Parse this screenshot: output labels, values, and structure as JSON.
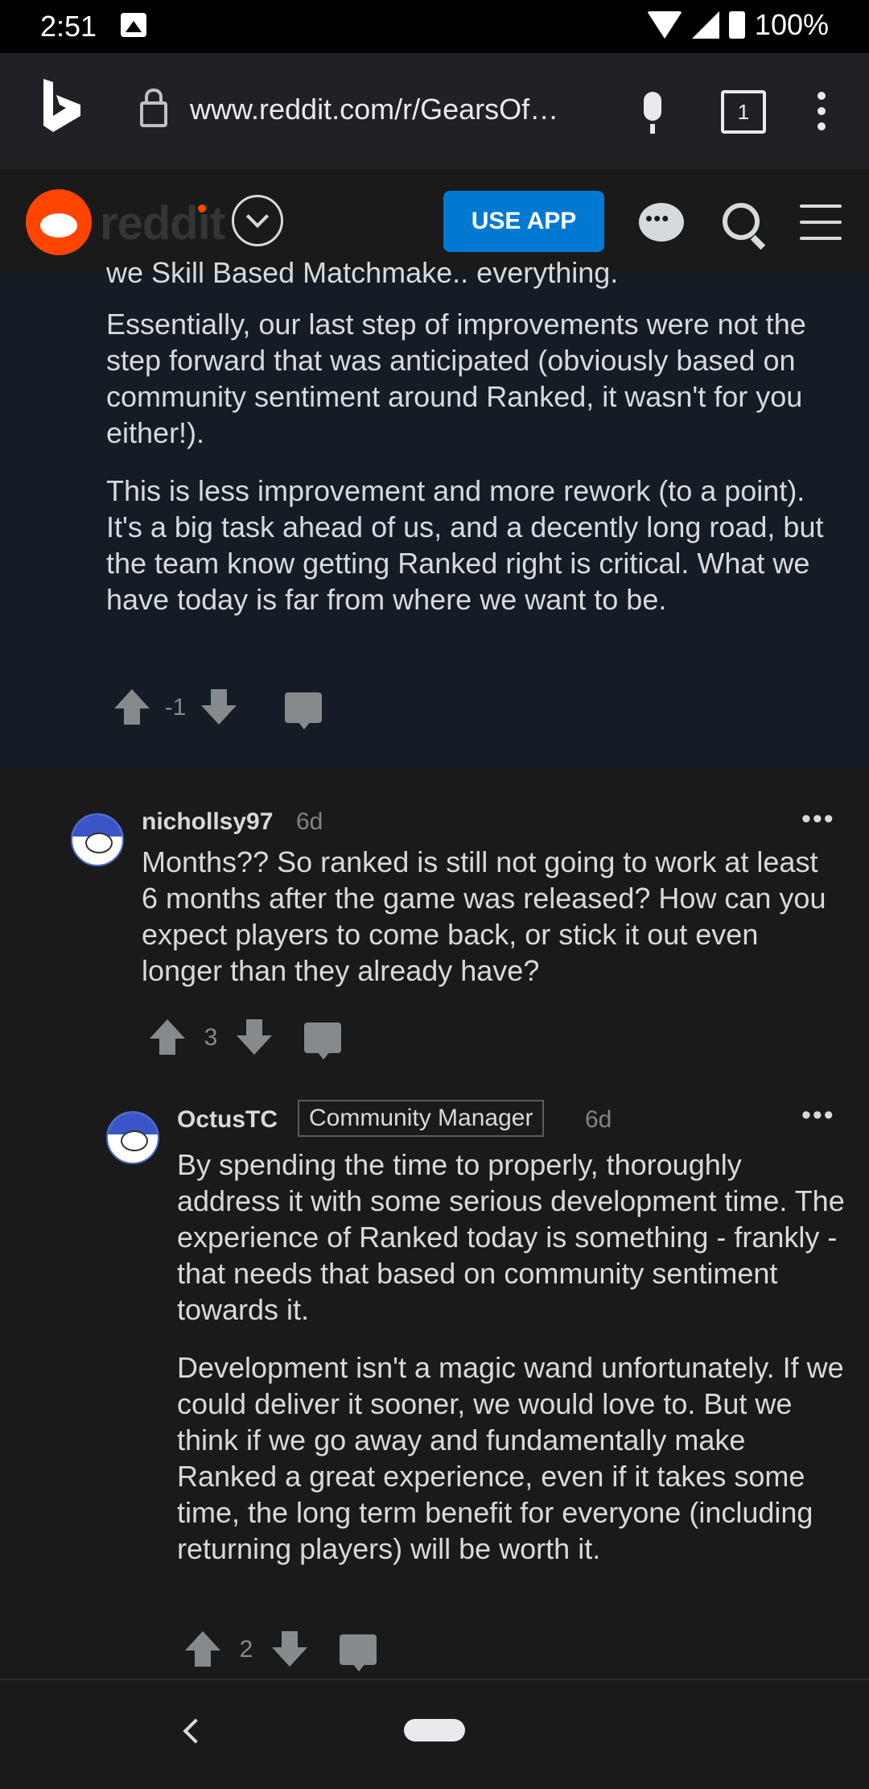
{
  "status_bar": {
    "time": "2:51",
    "battery": "100%"
  },
  "browser": {
    "url": "www.reddit.com/r/GearsOf…",
    "tab_count": "1"
  },
  "reddit_header": {
    "wordmark": "reddit",
    "use_app_label": "USE APP"
  },
  "parent_comment": {
    "cut_line": "we Skill Based Matchmake.. everything.",
    "paragraphs": [
      "Essentially, our last step of improvements were not the step forward that was anticipated (obviously based on community sentiment around Ranked, it wasn't for you either!).",
      "This is less improvement and more rework (to a point). It's a big task ahead of us, and a decently long road, but the team know getting Ranked right is critical. What we have today is far from where we want to be."
    ],
    "score": "-1"
  },
  "comments": [
    {
      "username": "nichollsy97",
      "age": "6d",
      "paragraphs": [
        "Months?? So ranked is still not going to work at least 6 months after the game was released? How can you expect players to come back, or stick it out even longer than they already have?"
      ],
      "score": "3"
    },
    {
      "username": "OctusTC",
      "flair": "Community Manager",
      "age": "6d",
      "paragraphs": [
        "By spending the time to properly, thoroughly address it with some serious development time. The experience of Ranked today is something - frankly - that needs that based on community sentiment towards it.",
        "Development isn't a magic wand unfortunately. If we could deliver it sooner, we would love to. But we think if we go away and fundamentally make Ranked a great experience, even if it takes some time, the long term benefit for everyone (including returning players) will be worth it."
      ],
      "score": "2"
    }
  ],
  "more_label": "•••"
}
